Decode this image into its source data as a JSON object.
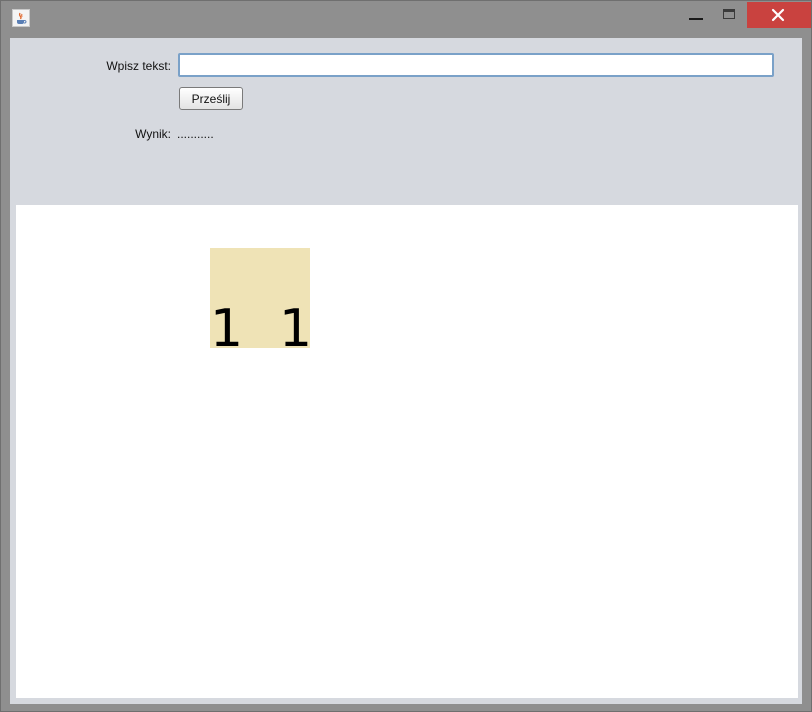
{
  "window": {
    "icon": "java-cup-icon",
    "controls": {
      "minimize_icon": "minimize-icon",
      "maximize_icon": "maximize-icon",
      "close_icon": "close-icon",
      "close_color": "#c9423f"
    }
  },
  "form": {
    "input_label": "Wpisz tekst:",
    "input_value": "",
    "submit_label": "Prześlij",
    "result_label": "Wynik:",
    "result_value": "..........."
  },
  "canvas": {
    "tile": {
      "color": "#efe3b6",
      "left_digit": "1",
      "right_digit": "1"
    }
  }
}
